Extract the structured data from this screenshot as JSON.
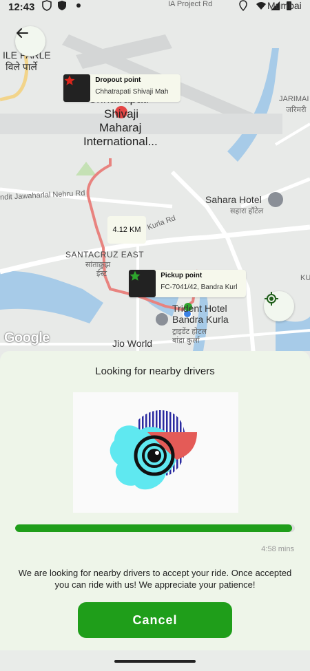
{
  "status_bar": {
    "time": "12:43"
  },
  "map": {
    "labels": {
      "vile_parle_en": "ILE PARLE",
      "vile_parle_hi": "विले पार्ले",
      "ia_project": "IA Project Rd",
      "mumbai": "Mumbai",
      "airport_line1": "Chhatrapati",
      "airport_line2": "Shivaji",
      "airport_line3": "Maharaj",
      "airport_line4": "International...",
      "jarimari_en": "JARIMAI",
      "jarimari_hi": "जरिमरी",
      "nehru_rd": "ndit Jawaharlal Nehru Rd",
      "kurla_rd": "Kurla Rd",
      "sahara_en": "Sahara Hotel",
      "sahara_hi": "सहारा हॉटेल",
      "santacruz_en": "SANTACRUZ EAST",
      "santacruz_hi1": "सांताक्रुझ",
      "santacruz_hi2": "ईस्ट",
      "trident_en1": "Trident Hotel",
      "trident_en2": "Bandra Kurla",
      "trident_hi1": "ट्राइडेंट होटल",
      "trident_hi2": "बांद्रा कुर्ला",
      "jio_world": "Jio World",
      "ku": "KU"
    },
    "dropout": {
      "title": "Dropout point",
      "address": "Chhatrapati Shivaji Mah"
    },
    "pickup": {
      "title": "Pickup point",
      "address": "FC-7041/42, Bandra Kurl"
    },
    "distance": "4.12 KM",
    "attribution": "Google"
  },
  "sheet": {
    "title": "Looking for nearby drivers",
    "progress_fraction": 0.99,
    "time_left": "4:58 mins",
    "description": "We are looking for nearby drivers to accept your ride. Once accepted you can ride with us! We appreciate your patience!",
    "cancel_label": "Cancel"
  },
  "colors": {
    "accent": "#1f9e1a",
    "route": "#e8837f",
    "dropout_star": "#d9261c",
    "pickup_star": "#2ea52d"
  }
}
